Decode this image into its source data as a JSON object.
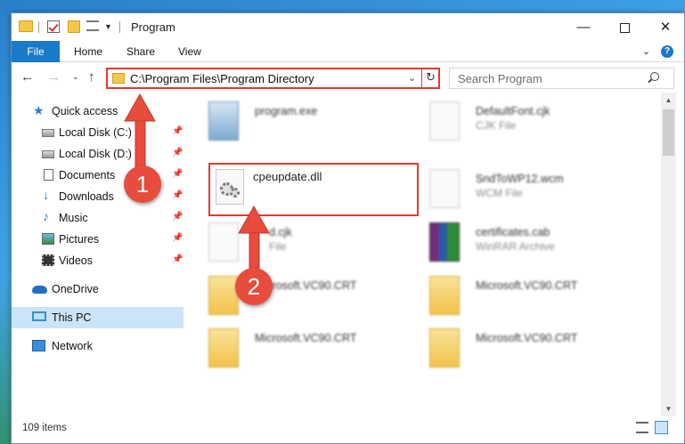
{
  "window": {
    "title": "Program",
    "ribbon_tabs": [
      "File",
      "Home",
      "Share",
      "View"
    ],
    "controls": {
      "minimize": "—",
      "close": "✕"
    }
  },
  "nav": {
    "address_path": "C:\\Program Files\\Program Directory",
    "search_placeholder": "Search Program"
  },
  "sidebar": {
    "items": [
      {
        "label": "Quick access",
        "icon": "star-icon"
      },
      {
        "label": "Local Disk (C:)",
        "icon": "disk-icon",
        "pinned": true
      },
      {
        "label": "Local Disk (D:)",
        "icon": "disk-icon",
        "pinned": true
      },
      {
        "label": "Documents",
        "icon": "documents-icon",
        "pinned": true
      },
      {
        "label": "Downloads",
        "icon": "download-icon",
        "pinned": true
      },
      {
        "label": "Music",
        "icon": "music-icon",
        "pinned": true
      },
      {
        "label": "Pictures",
        "icon": "pictures-icon",
        "pinned": true
      },
      {
        "label": "Videos",
        "icon": "videos-icon",
        "pinned": true
      },
      {
        "label": "OneDrive",
        "icon": "cloud-icon"
      },
      {
        "label": "This PC",
        "icon": "computer-icon",
        "selected": true
      },
      {
        "label": "Network",
        "icon": "network-icon"
      }
    ]
  },
  "files": [
    {
      "name": "program.exe",
      "type": ""
    },
    {
      "name": "DefaultFont.cjk",
      "type": "CJK File"
    },
    {
      "name": "cpeupdate.dll",
      "type": ""
    },
    {
      "name": "SndToWP12.wcm",
      "type": "WCM File"
    },
    {
      "name": "d.cjk",
      "type": "File"
    },
    {
      "name": "certificates.cab",
      "type": "WinRAR Archive"
    },
    {
      "name": "Microsoft.VC90.CRT",
      "type": ""
    },
    {
      "name": "Microsoft.VC90.CRT",
      "type": ""
    },
    {
      "name": "Microsoft.VC90.CRT",
      "type": ""
    },
    {
      "name": "Microsoft.VC90.CRT",
      "type": ""
    }
  ],
  "status": {
    "item_count": "109 items"
  },
  "annotations": {
    "badge1": "1",
    "badge2": "2"
  },
  "colors": {
    "accent": "#1979ca",
    "highlight": "#e03b2f",
    "selected": "#cce4f7"
  }
}
